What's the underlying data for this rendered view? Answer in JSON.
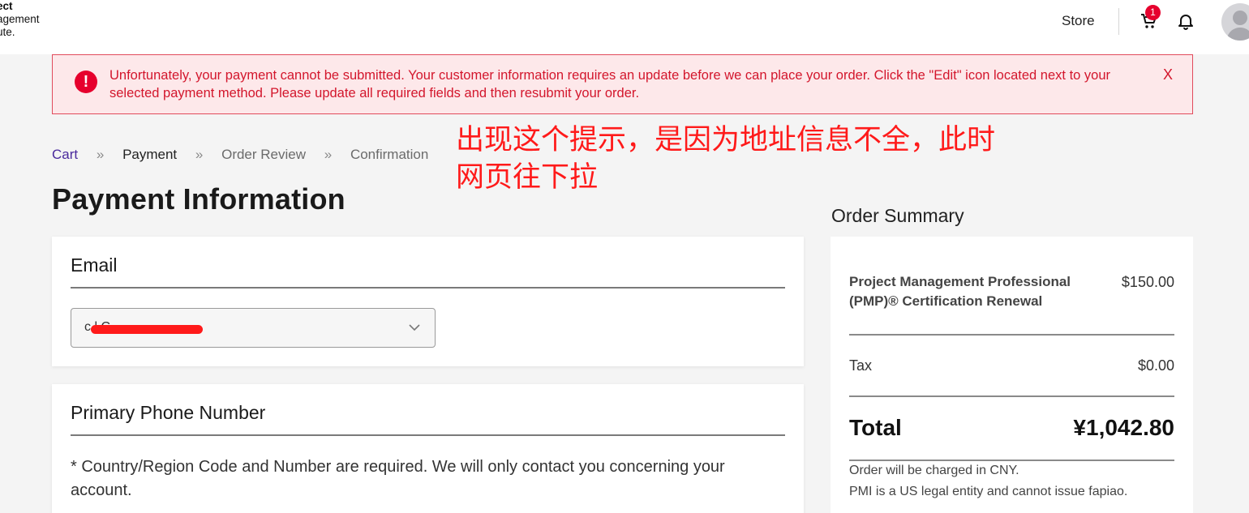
{
  "header": {
    "logo_lines": [
      "ect",
      "agement",
      "ute."
    ],
    "store_label": "Store",
    "cart_count": "1"
  },
  "alert": {
    "icon": "!",
    "message": "Unfortunately, your payment cannot be submitted. Your customer information requires an update before we can place your order. Click the \"Edit\" icon located next to your selected payment method. Please update all required fields and then resubmit your order.",
    "close_label": "X"
  },
  "breadcrumb": {
    "items": [
      "Cart",
      "Payment",
      "Order Review",
      "Confirmation"
    ],
    "separator": "»"
  },
  "annotation": "出现这个提示，是因为地址信息不全，此时网页往下拉",
  "page": {
    "title": "Payment Information"
  },
  "email_section": {
    "title": "Email",
    "selected_value": "c         l C"
  },
  "phone_section": {
    "title": "Primary Phone Number",
    "note": "* Country/Region Code and Number are required. We will only contact you concerning your account."
  },
  "order_summary": {
    "title": "Order Summary",
    "product_name": "Project Management Professional (PMP)® Certification Renewal",
    "product_price": "$150.00",
    "tax_label": "Tax",
    "tax_value": "$0.00",
    "total_label": "Total",
    "total_value": "¥1,042.80",
    "note_currency": "Order will be charged in CNY.",
    "note_fapiao": "PMI is a US legal entity and cannot issue fapiao."
  },
  "colors": {
    "error": "#d3162c",
    "error_bg": "#fde8ea",
    "badge": "#e6002d",
    "link": "#4a2a9c",
    "annotation": "#ff1a1a"
  }
}
